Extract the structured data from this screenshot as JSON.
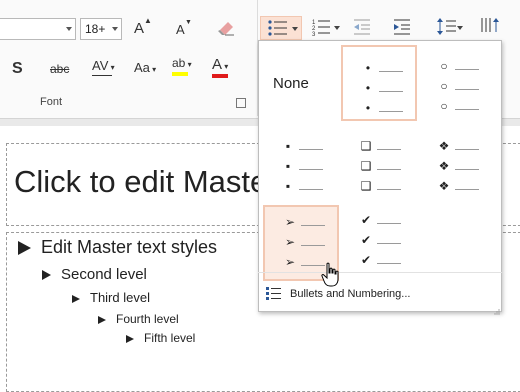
{
  "ribbon": {
    "font_size": "18+",
    "group_label": "Font",
    "buttons": {
      "grow": "A",
      "shrink": "A",
      "shadow": "S",
      "strike": "abc",
      "spacing": "AV",
      "case": "Aa",
      "highlight": "ab",
      "color": "A"
    },
    "colors": {
      "highlight": "#ffff00",
      "font_color": "#e01b1b",
      "accent": "#f2c7b1"
    }
  },
  "slide": {
    "title_placeholder": "Click to edit Maste",
    "levels": [
      "Edit Master text styles",
      "Second level",
      "Third level",
      "Fourth level",
      "Fifth level"
    ]
  },
  "bullet_menu": {
    "none_label": "None",
    "glyphs": {
      "small-dot": "•",
      "hollow-circle": "○",
      "filled-square": "▪",
      "hollow-square": "❑",
      "diamond-star": "❖",
      "arrow": "➢",
      "checkmark": "✔"
    },
    "footer_label": "Bullets and Numbering..."
  }
}
